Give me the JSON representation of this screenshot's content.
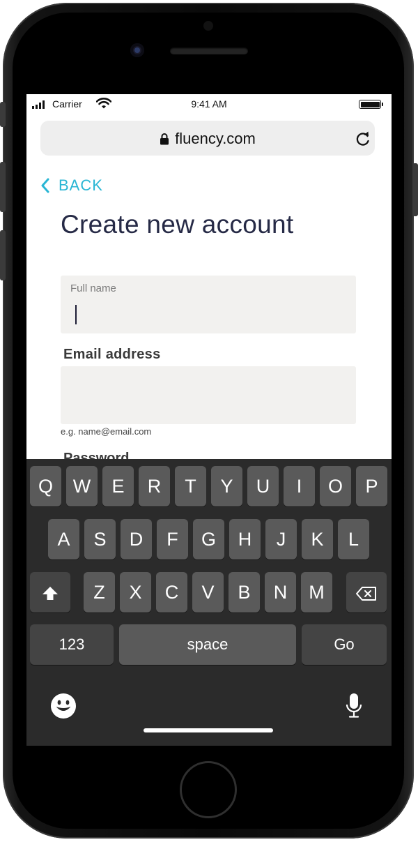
{
  "status_bar": {
    "carrier": "Carrier",
    "time": "9:41 AM"
  },
  "browser": {
    "url": "fluency.com"
  },
  "nav": {
    "back_label": "BACK"
  },
  "page": {
    "title": "Create new account"
  },
  "form": {
    "full_name": {
      "label": "Full name",
      "value": ""
    },
    "email": {
      "label": "Email address",
      "value": "",
      "hint": "e.g. name@email.com"
    },
    "password": {
      "label": "Password"
    }
  },
  "keyboard": {
    "row1": [
      "Q",
      "W",
      "E",
      "R",
      "T",
      "Y",
      "U",
      "I",
      "O",
      "P"
    ],
    "row2": [
      "A",
      "S",
      "D",
      "F",
      "G",
      "H",
      "J",
      "K",
      "L"
    ],
    "row3": [
      "Z",
      "X",
      "C",
      "V",
      "B",
      "N",
      "M"
    ],
    "numbers_label": "123",
    "space_label": "space",
    "go_label": "Go"
  },
  "colors": {
    "accent": "#2ab6d4",
    "title": "#262a46",
    "field_bg": "#f2f1ef",
    "keyboard_bg": "#2b2b2b",
    "key_bg": "#5a5a5a"
  },
  "icons": [
    "signal-icon",
    "wifi-icon",
    "battery-icon",
    "lock-icon",
    "reload-icon",
    "chevron-left-icon",
    "shift-icon",
    "backspace-icon",
    "emoji-icon",
    "microphone-icon"
  ]
}
